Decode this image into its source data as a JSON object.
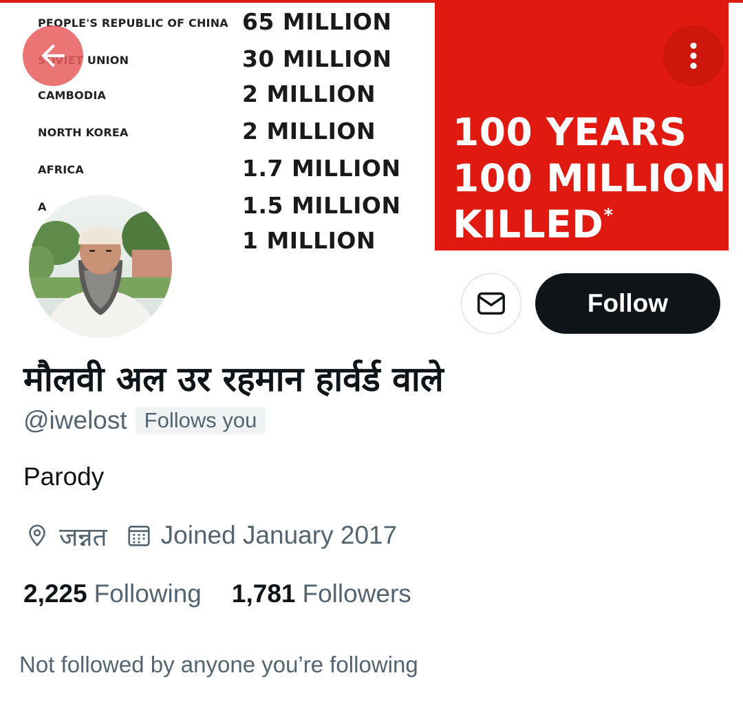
{
  "banner": {
    "tally": [
      {
        "country": "PEOPLE'S REPUBLIC OF CHINA",
        "count": "65 MILLION"
      },
      {
        "country": "SOVIET UNION",
        "count": "30 MILLION"
      },
      {
        "country": "CAMBODIA",
        "count": "2 MILLION"
      },
      {
        "country": "NORTH KOREA",
        "count": "2 MILLION"
      },
      {
        "country": "AFRICA",
        "count": "1.7 MILLION"
      },
      {
        "country": "A",
        "count": "1.5 MILLION"
      },
      {
        "country": "",
        "count": "1 MILLION"
      }
    ],
    "headline": {
      "line1": "100 YEARS",
      "line2": "100 MILLION",
      "line3": "KILLED",
      "mark": "*"
    },
    "colors": {
      "panel": "#e01a10"
    }
  },
  "navigation": {
    "back_icon": "arrow-left-icon",
    "more_icon": "more-vertical-icon"
  },
  "actions": {
    "message_icon": "mail-icon",
    "follow_label": "Follow"
  },
  "profile": {
    "display_name": "मौलवी अल उर रहमान हार्वर्ड वाले",
    "handle": "@iwelost",
    "follows_you": "Follows you",
    "bio": "Parody",
    "location": "जन्नत",
    "location_icon": "location-pin-icon",
    "joined": "Joined January 2017",
    "joined_icon": "calendar-icon",
    "following_count": "2,225",
    "following_label": "Following",
    "followers_count": "1,781",
    "followers_label": "Followers",
    "followed_by_note": "Not followed by anyone you’re following"
  },
  "colors": {
    "text_primary": "#0f1419",
    "text_secondary": "#536471",
    "button_dark": "#0f1419",
    "badge_bg": "#eff3f4"
  }
}
